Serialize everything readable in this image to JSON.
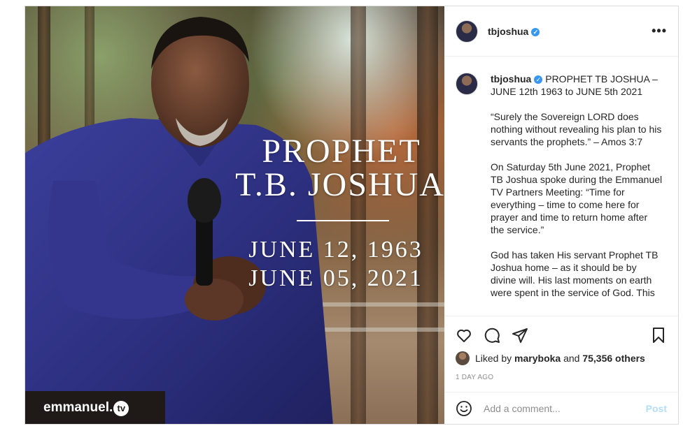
{
  "post": {
    "username": "tbjoshua",
    "more_label": "•••",
    "image_text": {
      "line1": "PROPHET",
      "line2": "T.B. JOSHUA",
      "line3": "JUNE 12, 1963",
      "line4": "JUNE 05, 2021",
      "logo": "emmanuel.",
      "logo_tv": "tv"
    },
    "caption": {
      "username": "tbjoshua",
      "paragraph1": "PROPHET TB JOSHUA – JUNE 12th 1963 to JUNE 5th 2021",
      "paragraph2": "“Surely the Sovereign LORD does nothing without revealing his plan to his servants the prophets.” – Amos 3:7",
      "paragraph3": "On Saturday 5th June 2021, Prophet TB Joshua spoke during the Emmanuel TV Partners Meeting: “Time for everything – time to come here for prayer and time to return home after the service.”",
      "paragraph4": "God has taken His servant Prophet TB Joshua home – as it should be by divine will. His last moments on earth were spent in the service of God. This"
    },
    "likes": {
      "prefix": "Liked by",
      "user": "maryboka",
      "joiner": "and",
      "count": "75,356 others"
    },
    "time_ago": "1 DAY AGO",
    "comment": {
      "placeholder": "Add a comment...",
      "post_label": "Post"
    }
  },
  "colors": {
    "verified": "#3897f0",
    "post_button_disabled": "#b2dffc",
    "border": "#dbdbdb"
  },
  "icons": [
    "heart-icon",
    "comment-icon",
    "share-icon",
    "bookmark-icon",
    "emoji-icon",
    "verified-icon",
    "more-options-icon"
  ]
}
